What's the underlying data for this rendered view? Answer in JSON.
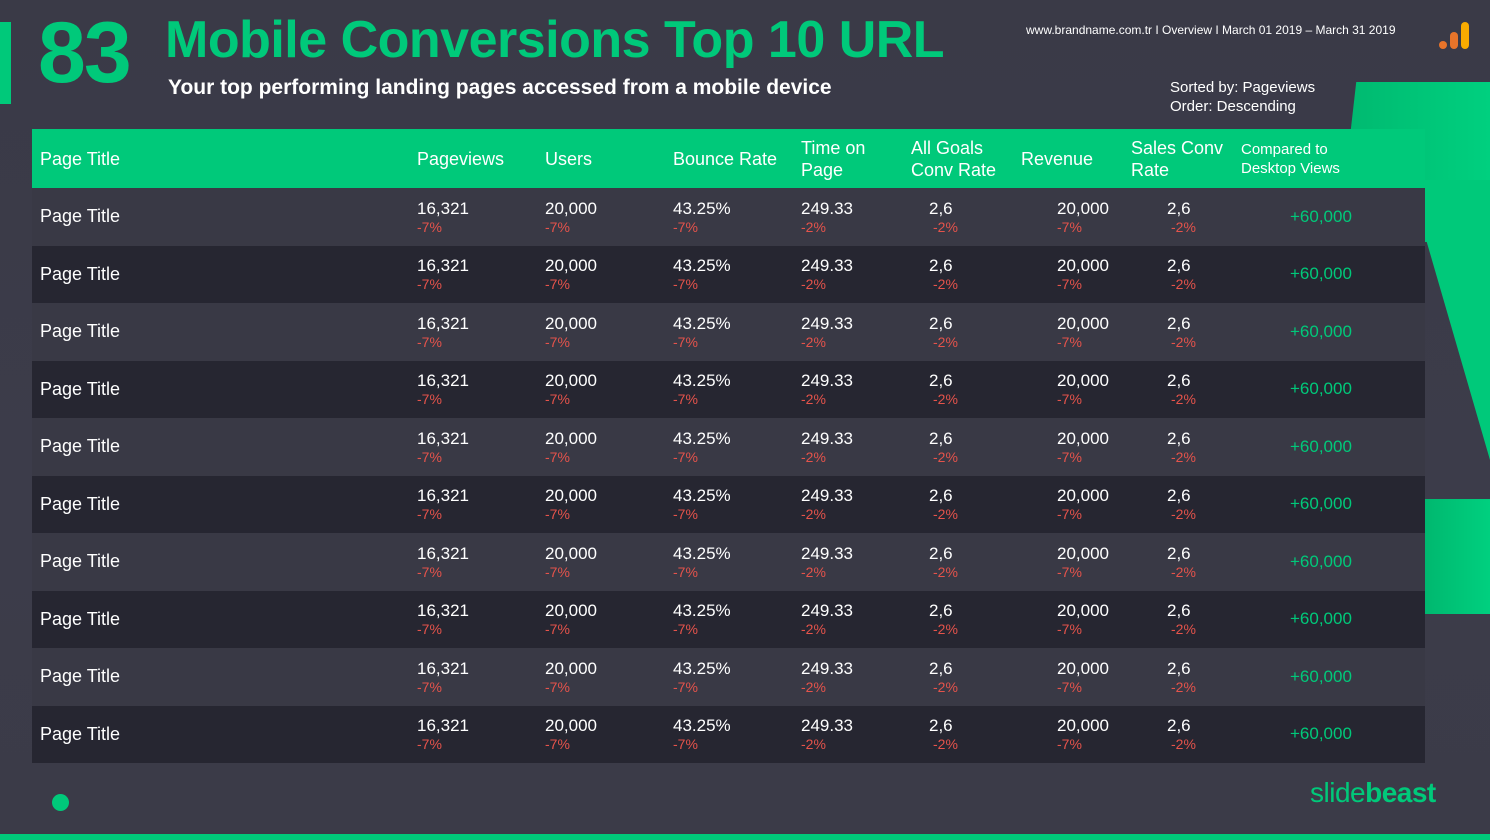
{
  "header": {
    "slide_number": "83",
    "title": "Mobile Conversions Top 10 URL",
    "subtitle": "Your top performing landing pages accessed from a mobile device",
    "meta": "www.brandname.com.tr I Overview I March 01 2019 – March 31 2019",
    "sorted_by": "Sorted by: Pageviews",
    "order": "Order: Descending",
    "icon": "analytics-bar-icon"
  },
  "colors": {
    "accent": "#00c97a",
    "negative": "#e5534b",
    "bg": "#3a3a47"
  },
  "table": {
    "columns": [
      "Page Title",
      "Pageviews",
      "Users",
      "Bounce Rate",
      "Time on Page",
      "All Goals Conv Rate",
      "Revenue",
      "Sales Conv Rate",
      "Compared to Desktop Views"
    ],
    "rows": [
      {
        "title": "Page Title",
        "pageviews": "16,321",
        "pageviews_chg": "-7%",
        "users": "20,000",
        "users_chg": "-7%",
        "bounce": "43.25%",
        "bounce_chg": "-7%",
        "time": "249.33",
        "time_chg": "-2%",
        "goals": "2,6",
        "goals_chg": "-2%",
        "revenue": "20,000",
        "revenue_chg": "-7%",
        "sales": "2,6",
        "sales_chg": "-2%",
        "compared": "+60,000"
      },
      {
        "title": "Page Title",
        "pageviews": "16,321",
        "pageviews_chg": "-7%",
        "users": "20,000",
        "users_chg": "-7%",
        "bounce": "43.25%",
        "bounce_chg": "-7%",
        "time": "249.33",
        "time_chg": "-2%",
        "goals": "2,6",
        "goals_chg": "-2%",
        "revenue": "20,000",
        "revenue_chg": "-7%",
        "sales": "2,6",
        "sales_chg": "-2%",
        "compared": "+60,000"
      },
      {
        "title": "Page Title",
        "pageviews": "16,321",
        "pageviews_chg": "-7%",
        "users": "20,000",
        "users_chg": "-7%",
        "bounce": "43.25%",
        "bounce_chg": "-7%",
        "time": "249.33",
        "time_chg": "-2%",
        "goals": "2,6",
        "goals_chg": "-2%",
        "revenue": "20,000",
        "revenue_chg": "-7%",
        "sales": "2,6",
        "sales_chg": "-2%",
        "compared": "+60,000"
      },
      {
        "title": "Page Title",
        "pageviews": "16,321",
        "pageviews_chg": "-7%",
        "users": "20,000",
        "users_chg": "-7%",
        "bounce": "43.25%",
        "bounce_chg": "-7%",
        "time": "249.33",
        "time_chg": "-2%",
        "goals": "2,6",
        "goals_chg": "-2%",
        "revenue": "20,000",
        "revenue_chg": "-7%",
        "sales": "2,6",
        "sales_chg": "-2%",
        "compared": "+60,000"
      },
      {
        "title": "Page Title",
        "pageviews": "16,321",
        "pageviews_chg": "-7%",
        "users": "20,000",
        "users_chg": "-7%",
        "bounce": "43.25%",
        "bounce_chg": "-7%",
        "time": "249.33",
        "time_chg": "-2%",
        "goals": "2,6",
        "goals_chg": "-2%",
        "revenue": "20,000",
        "revenue_chg": "-7%",
        "sales": "2,6",
        "sales_chg": "-2%",
        "compared": "+60,000"
      },
      {
        "title": "Page Title",
        "pageviews": "16,321",
        "pageviews_chg": "-7%",
        "users": "20,000",
        "users_chg": "-7%",
        "bounce": "43.25%",
        "bounce_chg": "-7%",
        "time": "249.33",
        "time_chg": "-2%",
        "goals": "2,6",
        "goals_chg": "-2%",
        "revenue": "20,000",
        "revenue_chg": "-7%",
        "sales": "2,6",
        "sales_chg": "-2%",
        "compared": "+60,000"
      },
      {
        "title": "Page Title",
        "pageviews": "16,321",
        "pageviews_chg": "-7%",
        "users": "20,000",
        "users_chg": "-7%",
        "bounce": "43.25%",
        "bounce_chg": "-7%",
        "time": "249.33",
        "time_chg": "-2%",
        "goals": "2,6",
        "goals_chg": "-2%",
        "revenue": "20,000",
        "revenue_chg": "-7%",
        "sales": "2,6",
        "sales_chg": "-2%",
        "compared": "+60,000"
      },
      {
        "title": "Page Title",
        "pageviews": "16,321",
        "pageviews_chg": "-7%",
        "users": "20,000",
        "users_chg": "-7%",
        "bounce": "43.25%",
        "bounce_chg": "-7%",
        "time": "249.33",
        "time_chg": "-2%",
        "goals": "2,6",
        "goals_chg": "-2%",
        "revenue": "20,000",
        "revenue_chg": "-7%",
        "sales": "2,6",
        "sales_chg": "-2%",
        "compared": "+60,000"
      },
      {
        "title": "Page Title",
        "pageviews": "16,321",
        "pageviews_chg": "-7%",
        "users": "20,000",
        "users_chg": "-7%",
        "bounce": "43.25%",
        "bounce_chg": "-7%",
        "time": "249.33",
        "time_chg": "-2%",
        "goals": "2,6",
        "goals_chg": "-2%",
        "revenue": "20,000",
        "revenue_chg": "-7%",
        "sales": "2,6",
        "sales_chg": "-2%",
        "compared": "+60,000"
      },
      {
        "title": "Page Title",
        "pageviews": "16,321",
        "pageviews_chg": "-7%",
        "users": "20,000",
        "users_chg": "-7%",
        "bounce": "43.25%",
        "bounce_chg": "-7%",
        "time": "249.33",
        "time_chg": "-2%",
        "goals": "2,6",
        "goals_chg": "-2%",
        "revenue": "20,000",
        "revenue_chg": "-7%",
        "sales": "2,6",
        "sales_chg": "-2%",
        "compared": "+60,000"
      }
    ]
  },
  "footer": {
    "brand_light": "slide",
    "brand_bold": "beast"
  }
}
